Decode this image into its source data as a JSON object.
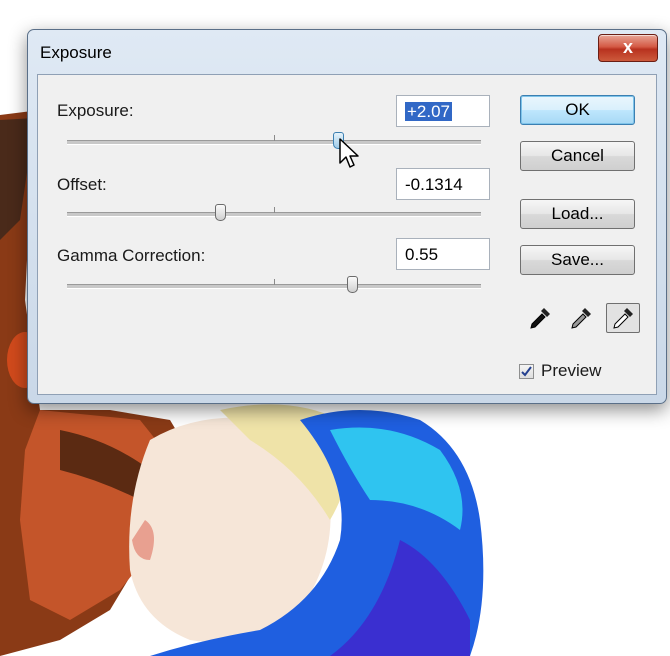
{
  "dialog": {
    "title": "Exposure",
    "close_label": "x"
  },
  "params": {
    "exposure": {
      "label": "Exposure:",
      "value": "+2.07"
    },
    "offset": {
      "label": "Offset:",
      "value": "-0.1314"
    },
    "gamma": {
      "label": "Gamma Correction:",
      "value": "0.55"
    }
  },
  "buttons": {
    "ok": "OK",
    "cancel": "Cancel",
    "load": "Load...",
    "save": "Save..."
  },
  "eyedroppers": [
    "black-point-eyedropper-icon",
    "gray-point-eyedropper-icon",
    "white-point-eyedropper-icon"
  ],
  "preview": {
    "label": "Preview",
    "checked": true
  },
  "colors": {
    "selection": "#3168c6",
    "default_button": "#bee6fd",
    "close_button": "#c94a33"
  }
}
